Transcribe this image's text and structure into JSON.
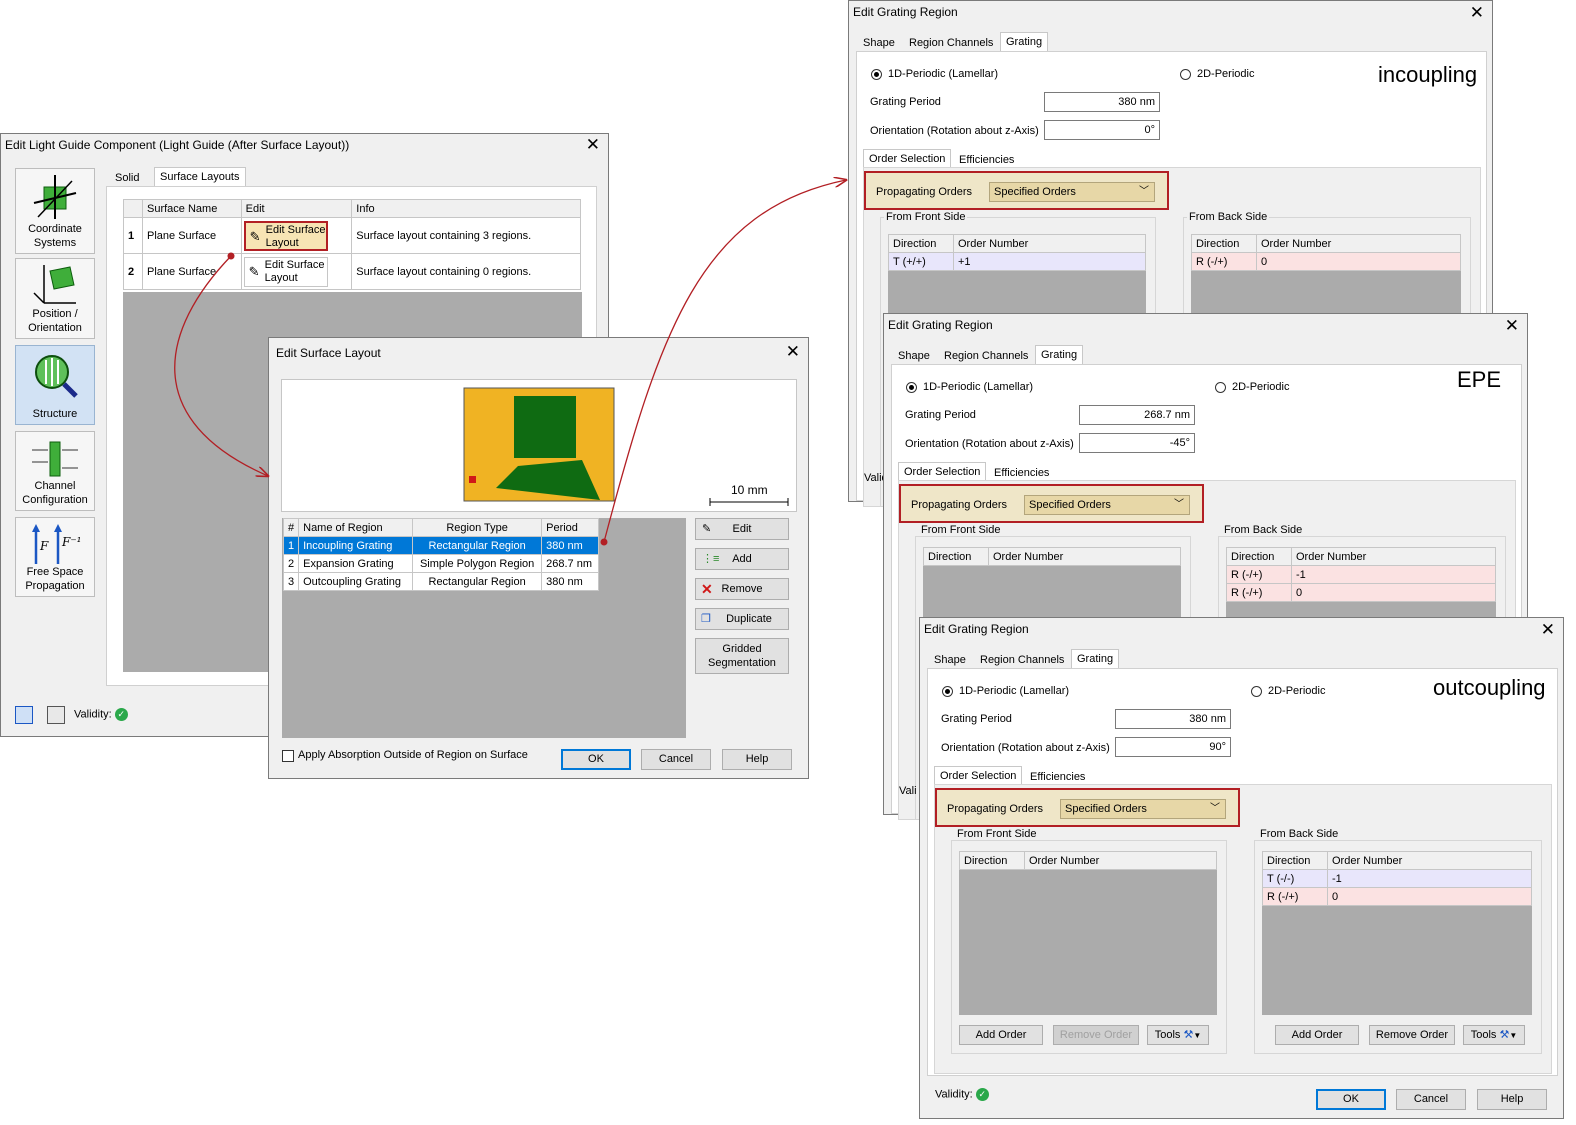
{
  "light_guide": {
    "title": "Edit Light Guide Component (Light Guide (After Surface Layout))",
    "sidebar": [
      {
        "label": "Coordinate Systems"
      },
      {
        "label": "Position / Orientation"
      },
      {
        "label": "Structure"
      },
      {
        "label": "Channel Configuration"
      },
      {
        "label": "Free Space Propagation"
      }
    ],
    "tabs": [
      "Solid",
      "Surface Layouts"
    ],
    "columns": [
      "Surface Name",
      "Edit",
      "Info"
    ],
    "rows": [
      {
        "num": "1",
        "name": "Plane Surface",
        "edit": "Edit Surface Layout",
        "info": "Surface layout containing 3 regions."
      },
      {
        "num": "2",
        "name": "Plane Surface",
        "edit": "Edit Surface Layout",
        "info": "Surface layout containing 0 regions."
      }
    ],
    "validity": "Validity:"
  },
  "surface_layout": {
    "title": "Edit Surface Layout",
    "scale": "10 mm",
    "columns": [
      "#",
      "Name of Region",
      "Region Type",
      "Period"
    ],
    "rows": [
      {
        "num": "1",
        "name": "Incoupling Grating",
        "type": "Rectangular Region",
        "period": "380 nm"
      },
      {
        "num": "2",
        "name": "Expansion Grating",
        "type": "Simple Polygon Region",
        "period": "268.7 nm"
      },
      {
        "num": "3",
        "name": "Outcoupling Grating",
        "type": "Rectangular Region",
        "period": "380 nm"
      }
    ],
    "buttons": {
      "edit": "Edit",
      "add": "Add",
      "remove": "Remove",
      "duplicate": "Duplicate",
      "gridded": "Gridded Segmentation"
    },
    "checkbox": "Apply Absorption Outside of Region on Surface",
    "ok": "OK",
    "cancel": "Cancel",
    "help": "Help"
  },
  "grating_common": {
    "title": "Edit Grating Region",
    "tabs": [
      "Shape",
      "Region Channels",
      "Grating"
    ],
    "radio_1d": "1D-Periodic (Lamellar)",
    "radio_2d": "2D-Periodic",
    "period_label": "Grating Period",
    "orientation_label": "Orientation (Rotation about z-Axis)",
    "subtabs": [
      "Order Selection",
      "Efficiencies"
    ],
    "prop_label": "Propagating Orders",
    "prop_value": "Specified Orders",
    "front": "From Front Side",
    "back": "From Back Side",
    "col_dir": "Direction",
    "col_order": "Order Number",
    "add_order": "Add Order",
    "remove_order": "Remove Order",
    "tools": "Tools",
    "validity": "Validity:",
    "validity_cut": "Validi",
    "validity_cut2": "Vali",
    "ok": "OK",
    "cancel": "Cancel",
    "help": "Help"
  },
  "incoupling": {
    "tag": "incoupling",
    "period": "380 nm",
    "orientation": "0°",
    "front": [
      {
        "dir": "T (+/+)",
        "order": "+1"
      }
    ],
    "back": [
      {
        "dir": "R (-/+)",
        "order": "0"
      }
    ]
  },
  "epe": {
    "tag": "EPE",
    "period": "268.7 nm",
    "orientation": "-45°",
    "front": [],
    "back": [
      {
        "dir": "R (-/+)",
        "order": "-1"
      },
      {
        "dir": "R (-/+)",
        "order": "0"
      }
    ]
  },
  "outcoupling": {
    "tag": "outcoupling",
    "period": "380 nm",
    "orientation": "90°",
    "front": [],
    "back": [
      {
        "dir": "T (-/-)",
        "order": "-1"
      },
      {
        "dir": "R (-/+)",
        "order": "0"
      }
    ]
  },
  "colors": {
    "accent": "#0078d7",
    "highlight": "#b21f24",
    "layout_bg": "#f0b323",
    "region": "#0f6b12",
    "row_blue": "#e8e6fb",
    "row_red": "#fbe2e2"
  }
}
